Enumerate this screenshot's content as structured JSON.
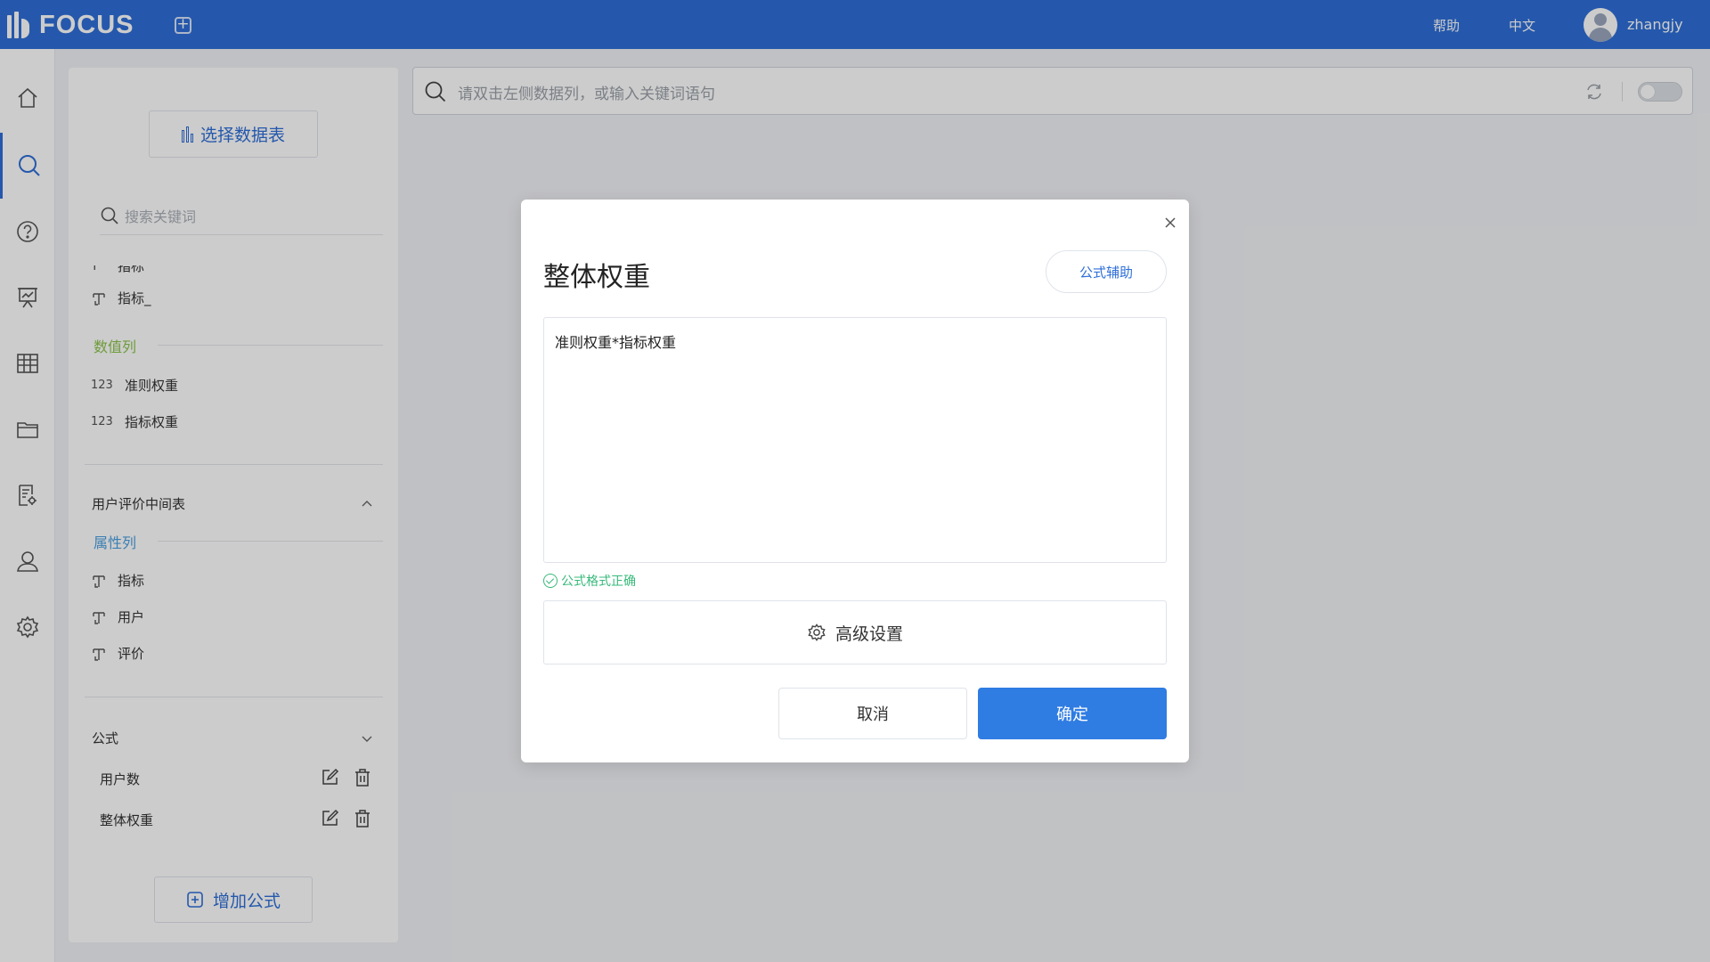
{
  "header": {
    "brand": "FOCUS",
    "help_label": "帮助",
    "language_label": "中文",
    "username": "zhangjy"
  },
  "colors": {
    "primary": "#2f6fd8",
    "numeric_section": "#8bc34a",
    "attribute_section": "#4a9fe0",
    "success": "#38b97b"
  },
  "nav": {
    "items": [
      {
        "name": "home",
        "icon": "home-icon"
      },
      {
        "name": "search",
        "icon": "search-icon",
        "active": true
      },
      {
        "name": "help",
        "icon": "question-icon"
      },
      {
        "name": "dashboard",
        "icon": "presentation-icon"
      },
      {
        "name": "table",
        "icon": "table-icon"
      },
      {
        "name": "folder",
        "icon": "folder-icon"
      },
      {
        "name": "data-settings",
        "icon": "document-settings-icon"
      },
      {
        "name": "user",
        "icon": "user-icon"
      },
      {
        "name": "settings",
        "icon": "gear-icon"
      }
    ]
  },
  "datapanel": {
    "select_table_label": "选择数据表",
    "search_placeholder": "搜索关键词",
    "clipped_item": "指标",
    "table1_items": [
      {
        "type_icon": "text-type-icon",
        "label": "指标_"
      }
    ],
    "numeric_section_label": "数值列",
    "numeric_items": [
      {
        "type": "123",
        "label": "准则权重"
      },
      {
        "type": "123",
        "label": "指标权重"
      }
    ],
    "table2": {
      "name": "用户评价中间表",
      "attribute_section_label": "属性列",
      "items": [
        {
          "label": "指标"
        },
        {
          "label": "用户"
        },
        {
          "label": "评价"
        }
      ]
    },
    "formula_group": {
      "name": "公式",
      "items": [
        {
          "label": "用户数"
        },
        {
          "label": "整体权重"
        }
      ]
    },
    "add_formula_label": "增加公式"
  },
  "mainsearch": {
    "placeholder": "请双击左侧数据列，或输入关键词语句"
  },
  "modal": {
    "title": "整体权重",
    "formula_help_label": "公式辅助",
    "formula_value": "准则权重*指标权重",
    "validation_message": "公式格式正确",
    "advanced_label": "高级设置",
    "cancel_label": "取消",
    "confirm_label": "确定"
  }
}
